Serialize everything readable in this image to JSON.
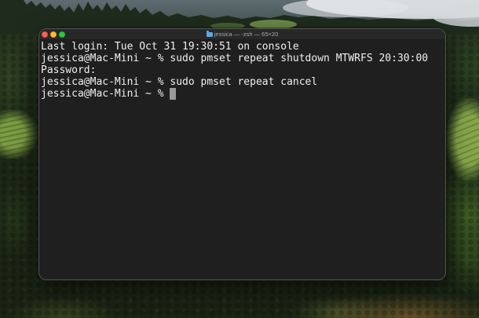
{
  "window": {
    "title": "jessica — -zsh — 65×20",
    "title_icon": "folder-icon",
    "controls": {
      "close_color": "#ff5f57",
      "minimize_color": "#febc2e",
      "zoom_color": "#28c840"
    }
  },
  "terminal": {
    "colors": {
      "background": "#1f1f1f",
      "text": "#efefef",
      "cursor": "#9a9a9a"
    },
    "lines": [
      {
        "text": "Last login: Tue Oct 31 19:30:51 on console"
      },
      {
        "prompt": "jessica@Mac-Mini ~ %",
        "command": "sudo pmset repeat shutdown MTWRFS 20:30:00"
      },
      {
        "text": "Password:"
      },
      {
        "prompt": "jessica@Mac-Mini ~ %",
        "command": "sudo pmset repeat cancel"
      },
      {
        "prompt": "jessica@Mac-Mini ~ %"
      }
    ]
  }
}
